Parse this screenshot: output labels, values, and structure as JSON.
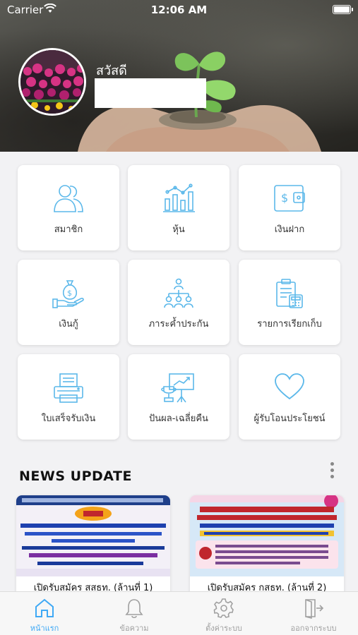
{
  "status_bar": {
    "carrier": "Carrier",
    "time": "12:06 AM"
  },
  "header": {
    "greeting": "สวัสดี",
    "user_name": ""
  },
  "menu": [
    {
      "label": "สมาชิก",
      "icon": "members-icon"
    },
    {
      "label": "หุ้น",
      "icon": "bar-chart-icon"
    },
    {
      "label": "เงินฝาก",
      "icon": "wallet-icon"
    },
    {
      "label": "เงินกู้",
      "icon": "money-bag-hand-icon"
    },
    {
      "label": "ภาระค้ำประกัน",
      "icon": "people-network-icon"
    },
    {
      "label": "รายการเรียกเก็บ",
      "icon": "document-calculator-icon"
    },
    {
      "label": "ใบเสร็จรับเงิน",
      "icon": "printer-icon"
    },
    {
      "label": "ปันผล-เฉลี่ยคืน",
      "icon": "trophy-presentation-icon"
    },
    {
      "label": "ผู้รับโอนประโยชน์",
      "icon": "heart-icon"
    }
  ],
  "news": {
    "title": "NEWS UPDATE",
    "items": [
      {
        "caption": "เปิดรับสมัคร สสธท. (ล้านที่ 1)"
      },
      {
        "caption": "เปิดรับสมัคร กสธท. (ล้านที่ 2)"
      }
    ]
  },
  "tabs": [
    {
      "label": "หน้าแรก",
      "icon": "home-icon",
      "active": true
    },
    {
      "label": "ข้อความ",
      "icon": "bell-icon",
      "active": false
    },
    {
      "label": "ตั้งค่าระบบ",
      "icon": "gear-icon",
      "active": false
    },
    {
      "label": "ออกจากระบบ",
      "icon": "logout-icon",
      "active": false
    }
  ],
  "colors": {
    "accent": "#3fa9f5",
    "icon_stroke": "#5bb8ea",
    "tab_inactive": "#a0a0a0"
  }
}
